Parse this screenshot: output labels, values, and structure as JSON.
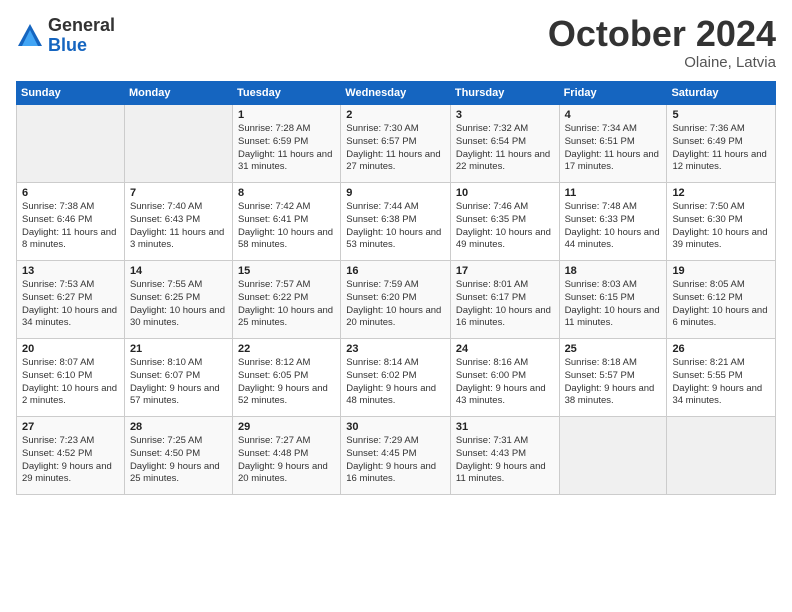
{
  "logo": {
    "general": "General",
    "blue": "Blue"
  },
  "header": {
    "month_year": "October 2024",
    "location": "Olaine, Latvia"
  },
  "weekdays": [
    "Sunday",
    "Monday",
    "Tuesday",
    "Wednesday",
    "Thursday",
    "Friday",
    "Saturday"
  ],
  "weeks": [
    [
      {
        "day": "",
        "empty": true
      },
      {
        "day": "",
        "empty": true
      },
      {
        "day": "1",
        "sunrise": "7:28 AM",
        "sunset": "6:59 PM",
        "daylight": "11 hours and 31 minutes."
      },
      {
        "day": "2",
        "sunrise": "7:30 AM",
        "sunset": "6:57 PM",
        "daylight": "11 hours and 27 minutes."
      },
      {
        "day": "3",
        "sunrise": "7:32 AM",
        "sunset": "6:54 PM",
        "daylight": "11 hours and 22 minutes."
      },
      {
        "day": "4",
        "sunrise": "7:34 AM",
        "sunset": "6:51 PM",
        "daylight": "11 hours and 17 minutes."
      },
      {
        "day": "5",
        "sunrise": "7:36 AM",
        "sunset": "6:49 PM",
        "daylight": "11 hours and 12 minutes."
      }
    ],
    [
      {
        "day": "6",
        "sunrise": "7:38 AM",
        "sunset": "6:46 PM",
        "daylight": "11 hours and 8 minutes."
      },
      {
        "day": "7",
        "sunrise": "7:40 AM",
        "sunset": "6:43 PM",
        "daylight": "11 hours and 3 minutes."
      },
      {
        "day": "8",
        "sunrise": "7:42 AM",
        "sunset": "6:41 PM",
        "daylight": "10 hours and 58 minutes."
      },
      {
        "day": "9",
        "sunrise": "7:44 AM",
        "sunset": "6:38 PM",
        "daylight": "10 hours and 53 minutes."
      },
      {
        "day": "10",
        "sunrise": "7:46 AM",
        "sunset": "6:35 PM",
        "daylight": "10 hours and 49 minutes."
      },
      {
        "day": "11",
        "sunrise": "7:48 AM",
        "sunset": "6:33 PM",
        "daylight": "10 hours and 44 minutes."
      },
      {
        "day": "12",
        "sunrise": "7:50 AM",
        "sunset": "6:30 PM",
        "daylight": "10 hours and 39 minutes."
      }
    ],
    [
      {
        "day": "13",
        "sunrise": "7:53 AM",
        "sunset": "6:27 PM",
        "daylight": "10 hours and 34 minutes."
      },
      {
        "day": "14",
        "sunrise": "7:55 AM",
        "sunset": "6:25 PM",
        "daylight": "10 hours and 30 minutes."
      },
      {
        "day": "15",
        "sunrise": "7:57 AM",
        "sunset": "6:22 PM",
        "daylight": "10 hours and 25 minutes."
      },
      {
        "day": "16",
        "sunrise": "7:59 AM",
        "sunset": "6:20 PM",
        "daylight": "10 hours and 20 minutes."
      },
      {
        "day": "17",
        "sunrise": "8:01 AM",
        "sunset": "6:17 PM",
        "daylight": "10 hours and 16 minutes."
      },
      {
        "day": "18",
        "sunrise": "8:03 AM",
        "sunset": "6:15 PM",
        "daylight": "10 hours and 11 minutes."
      },
      {
        "day": "19",
        "sunrise": "8:05 AM",
        "sunset": "6:12 PM",
        "daylight": "10 hours and 6 minutes."
      }
    ],
    [
      {
        "day": "20",
        "sunrise": "8:07 AM",
        "sunset": "6:10 PM",
        "daylight": "10 hours and 2 minutes."
      },
      {
        "day": "21",
        "sunrise": "8:10 AM",
        "sunset": "6:07 PM",
        "daylight": "9 hours and 57 minutes."
      },
      {
        "day": "22",
        "sunrise": "8:12 AM",
        "sunset": "6:05 PM",
        "daylight": "9 hours and 52 minutes."
      },
      {
        "day": "23",
        "sunrise": "8:14 AM",
        "sunset": "6:02 PM",
        "daylight": "9 hours and 48 minutes."
      },
      {
        "day": "24",
        "sunrise": "8:16 AM",
        "sunset": "6:00 PM",
        "daylight": "9 hours and 43 minutes."
      },
      {
        "day": "25",
        "sunrise": "8:18 AM",
        "sunset": "5:57 PM",
        "daylight": "9 hours and 38 minutes."
      },
      {
        "day": "26",
        "sunrise": "8:21 AM",
        "sunset": "5:55 PM",
        "daylight": "9 hours and 34 minutes."
      }
    ],
    [
      {
        "day": "27",
        "sunrise": "7:23 AM",
        "sunset": "4:52 PM",
        "daylight": "9 hours and 29 minutes."
      },
      {
        "day": "28",
        "sunrise": "7:25 AM",
        "sunset": "4:50 PM",
        "daylight": "9 hours and 25 minutes."
      },
      {
        "day": "29",
        "sunrise": "7:27 AM",
        "sunset": "4:48 PM",
        "daylight": "9 hours and 20 minutes."
      },
      {
        "day": "30",
        "sunrise": "7:29 AM",
        "sunset": "4:45 PM",
        "daylight": "9 hours and 16 minutes."
      },
      {
        "day": "31",
        "sunrise": "7:31 AM",
        "sunset": "4:43 PM",
        "daylight": "9 hours and 11 minutes."
      },
      {
        "day": "",
        "empty": true
      },
      {
        "day": "",
        "empty": true
      }
    ]
  ]
}
